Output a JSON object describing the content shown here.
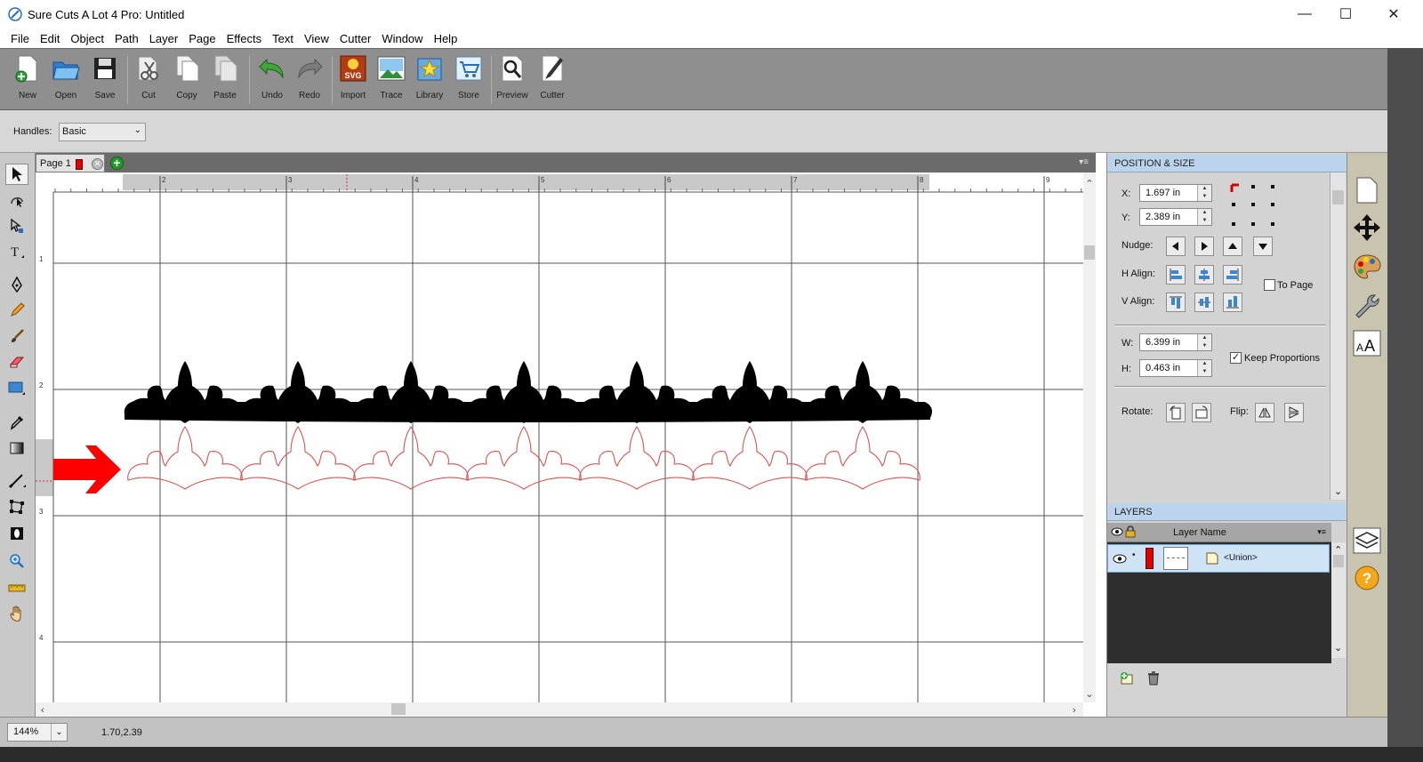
{
  "window": {
    "title": "Sure Cuts A Lot 4 Pro: Untitled",
    "min_glyph": "—",
    "max_glyph": "☐",
    "close_glyph": "✕"
  },
  "menu": [
    "File",
    "Edit",
    "Object",
    "Path",
    "Layer",
    "Page",
    "Effects",
    "Text",
    "View",
    "Cutter",
    "Window",
    "Help"
  ],
  "toolbar": {
    "buttons": [
      {
        "label": "New",
        "icon": "new-document-icon"
      },
      {
        "label": "Open",
        "icon": "open-folder-icon"
      },
      {
        "label": "Save",
        "icon": "floppy-disk-icon"
      },
      {
        "label": "Cut",
        "icon": "scissors-icon"
      },
      {
        "label": "Copy",
        "icon": "copy-icon"
      },
      {
        "label": "Paste",
        "icon": "paste-icon"
      },
      {
        "label": "Undo",
        "icon": "undo-icon"
      },
      {
        "label": "Redo",
        "icon": "redo-icon"
      },
      {
        "label": "Import",
        "icon": "svg-import-icon"
      },
      {
        "label": "Trace",
        "icon": "trace-picture-icon"
      },
      {
        "label": "Library",
        "icon": "library-star-icon"
      },
      {
        "label": "Store",
        "icon": "cart-icon"
      },
      {
        "label": "Preview",
        "icon": "magnifier-icon"
      },
      {
        "label": "Cutter",
        "icon": "cutter-blade-icon"
      }
    ],
    "svg_badge": "SVG"
  },
  "handles": {
    "label": "Handles:",
    "value": "Basic"
  },
  "page_tab": {
    "label": "Page 1",
    "color": "#e00000",
    "close_glyph": "✕",
    "add_glyph": "+",
    "menu_glyph": "▾≡"
  },
  "ruler": {
    "h_labels": [
      "2",
      "3",
      "4",
      "5",
      "6",
      "7",
      "8",
      "9"
    ],
    "v_labels": [
      "1",
      "2",
      "3",
      "4"
    ]
  },
  "canvas": {
    "pointer_arrow_color": "#ff0000",
    "fill_color": "#000000",
    "outline_color": "#e05050"
  },
  "position_size": {
    "header": "POSITION & SIZE",
    "x_label": "X:",
    "x_value": "1.697 in",
    "y_label": "Y:",
    "y_value": "2.389 in",
    "nudge_label": "Nudge:",
    "h_align_label": "H Align:",
    "v_align_label": "V Align:",
    "to_page_label": "To Page",
    "to_page_checked": false,
    "w_label": "W:",
    "w_value": "6.399 in",
    "h_label": "H:",
    "h_value": "0.463 in",
    "keep_proportions_label": "Keep Proportions",
    "keep_proportions_checked": true,
    "check_glyph": "✓",
    "rotate_label": "Rotate:",
    "flip_label": "Flip:"
  },
  "layers": {
    "header": "LAYERS",
    "column_label": "Layer Name",
    "menu_glyph": "▾≡",
    "rows": [
      {
        "name": "<Union>",
        "color": "#e00000"
      }
    ]
  },
  "status": {
    "zoom": "144%",
    "coords": "1.70,2.39"
  }
}
